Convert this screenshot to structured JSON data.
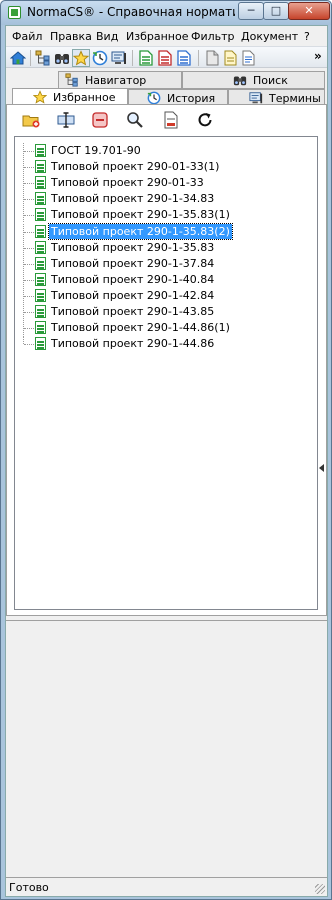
{
  "window": {
    "title": "NormaCS® - Справочная нормативная с...",
    "minimize_label": "─",
    "maximize_label": "□",
    "close_label": "✕"
  },
  "menu": [
    "Файл",
    "Правка",
    "Вид",
    "Избранное",
    "Фильтр",
    "Документ",
    "?"
  ],
  "toolbar": {
    "overflow_label": "»",
    "buttons": [
      "home-icon",
      "tree-icon",
      "binoculars-icon",
      "star-icon",
      "history-icon",
      "terms-icon",
      "doc-green-icon",
      "doc-red-icon",
      "doc-blue-icon",
      "doc-gray-icon",
      "doc-yellow-icon",
      "doc-notes-icon"
    ]
  },
  "tabs": {
    "row_back": [
      {
        "label": "Навигатор",
        "icon": "tree-icon"
      },
      {
        "label": "Поиск",
        "icon": "binoculars-icon"
      }
    ],
    "row_front": [
      {
        "label": "Избранное",
        "icon": "star-icon",
        "active": true
      },
      {
        "label": "История",
        "icon": "history-icon"
      },
      {
        "label": "Термины",
        "icon": "terms-icon"
      }
    ]
  },
  "panel_tools": [
    "add-folder-icon",
    "rename-icon",
    "remove-icon",
    "search-icon",
    "export-icon",
    "refresh-icon"
  ],
  "favorites": [
    "ГОСТ 19.701-90",
    "Типовой проект 290-01-33(1)",
    "Типовой проект 290-01-33",
    "Типовой проект 290-1-34.83",
    "Типовой проект 290-1-35.83(1)",
    "Типовой проект 290-1-35.83(2)",
    "Типовой проект 290-1-35.83",
    "Типовой проект 290-1-37.84",
    "Типовой проект 290-1-40.84",
    "Типовой проект 290-1-42.84",
    "Типовой проект 290-1-43.85",
    "Типовой проект 290-1-44.86(1)",
    "Типовой проект 290-1-44.86"
  ],
  "selected_index": 5,
  "status": "Готово",
  "colors": {
    "accent": "#3399ff",
    "doc_green": "#2a9a3a",
    "title_bar": "#a9c4dc"
  }
}
